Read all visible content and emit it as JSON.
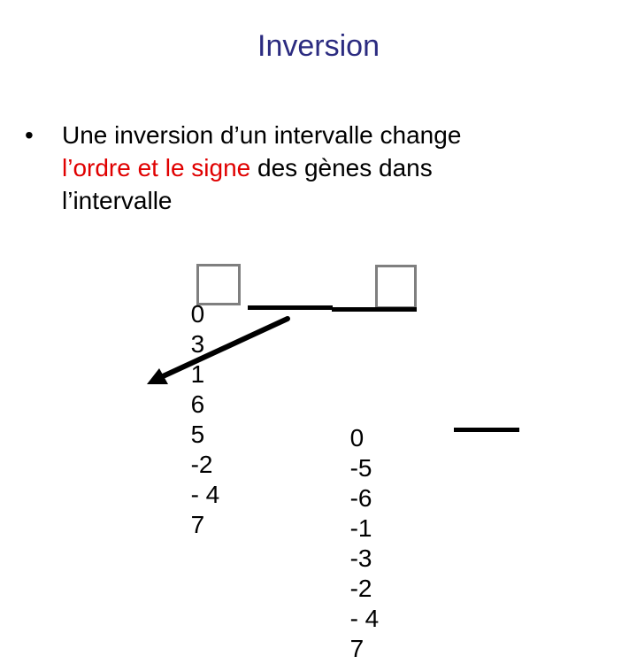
{
  "slide": {
    "title": "Inversion",
    "title_color": "#2b2b80",
    "bullet": {
      "marker": "•",
      "line1": "Une inversion d’un intervalle change",
      "highlight": "l’ordre et le signe",
      "highlight_color": "#e00000",
      "line2_rest": " des gènes dans",
      "line3": "l’intervalle"
    },
    "sequence_before": {
      "tokens": [
        "0",
        "3",
        "1",
        "6",
        "5",
        "-2",
        "- 4",
        "7"
      ],
      "boxed_tokens": [
        "3",
        "- 4"
      ],
      "box_color": "#7f7f7f"
    },
    "sequence_after": {
      "tokens": [
        "0",
        "-5",
        "-6",
        "-1",
        "-3",
        "-2",
        "- 4",
        "7"
      ]
    },
    "arrow": {
      "icon": "arrow-down-left-icon",
      "color": "#000000"
    }
  }
}
